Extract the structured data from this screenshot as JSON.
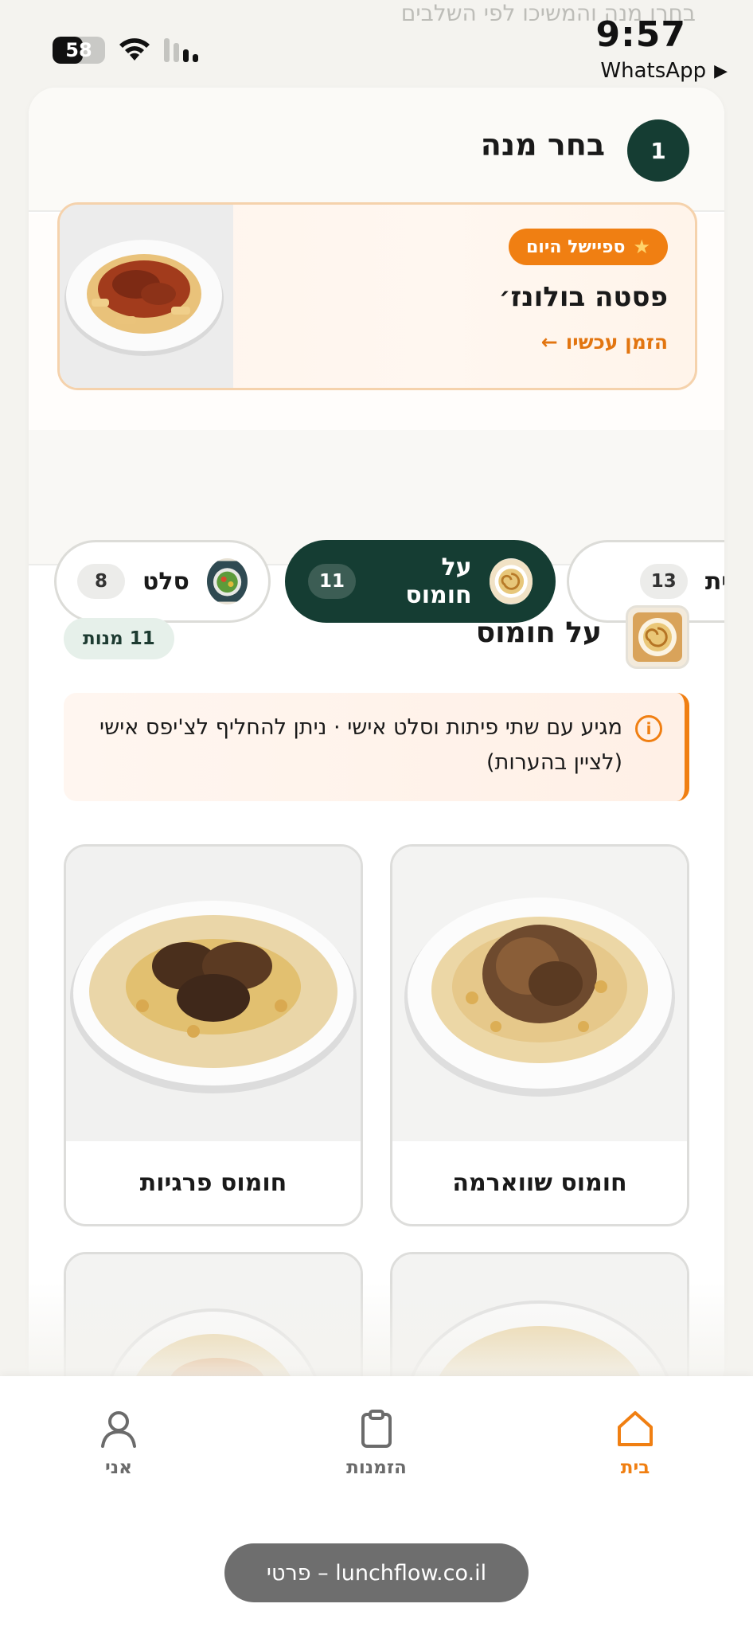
{
  "ghost_text": "בחרו מנה והמשיכו לפי השלבים",
  "status_bar": {
    "time": "9:57",
    "back_app": "WhatsApp",
    "battery": "58",
    "battery_level": 0.58
  },
  "step": {
    "number": "1",
    "title": "בחר מנה"
  },
  "daily_special": {
    "badge": "ספיישל היום",
    "badge_icon": "star-icon",
    "name": "פסטה בולונז׳",
    "cta": "הזמן עכשיו"
  },
  "categories": [
    {
      "label": "סלט",
      "count": "8",
      "active": false,
      "icon": "salad-bowl-icon"
    },
    {
      "label": "על חומוס",
      "count": "11",
      "active": true,
      "icon": "hummus-plate-icon"
    },
    {
      "label": "מגשית",
      "count": "13",
      "active": false,
      "icon": "tray-icon"
    }
  ],
  "section": {
    "title": "על חומוס",
    "count_badge": "11 מנות",
    "note": "מגיע עם שתי פיתות וסלט אישי · ניתן להחליף לצ'יפס אישי (לציין בהערות)"
  },
  "dishes": [
    {
      "name": "חומוס שווארמה"
    },
    {
      "name": "חומוס פרגיות"
    },
    {
      "name": ""
    },
    {
      "name": ""
    }
  ],
  "nav": [
    {
      "label": "בית",
      "icon": "home-icon",
      "active": true
    },
    {
      "label": "הזמנות",
      "icon": "clipboard-icon",
      "active": false
    },
    {
      "label": "אני",
      "icon": "user-icon",
      "active": false
    }
  ],
  "url_bar": "lunchflow.co.il – פרטי",
  "colors": {
    "brand_dark": "#153d33",
    "accent_orange": "#f07f12",
    "background": "#f4f3ef"
  }
}
